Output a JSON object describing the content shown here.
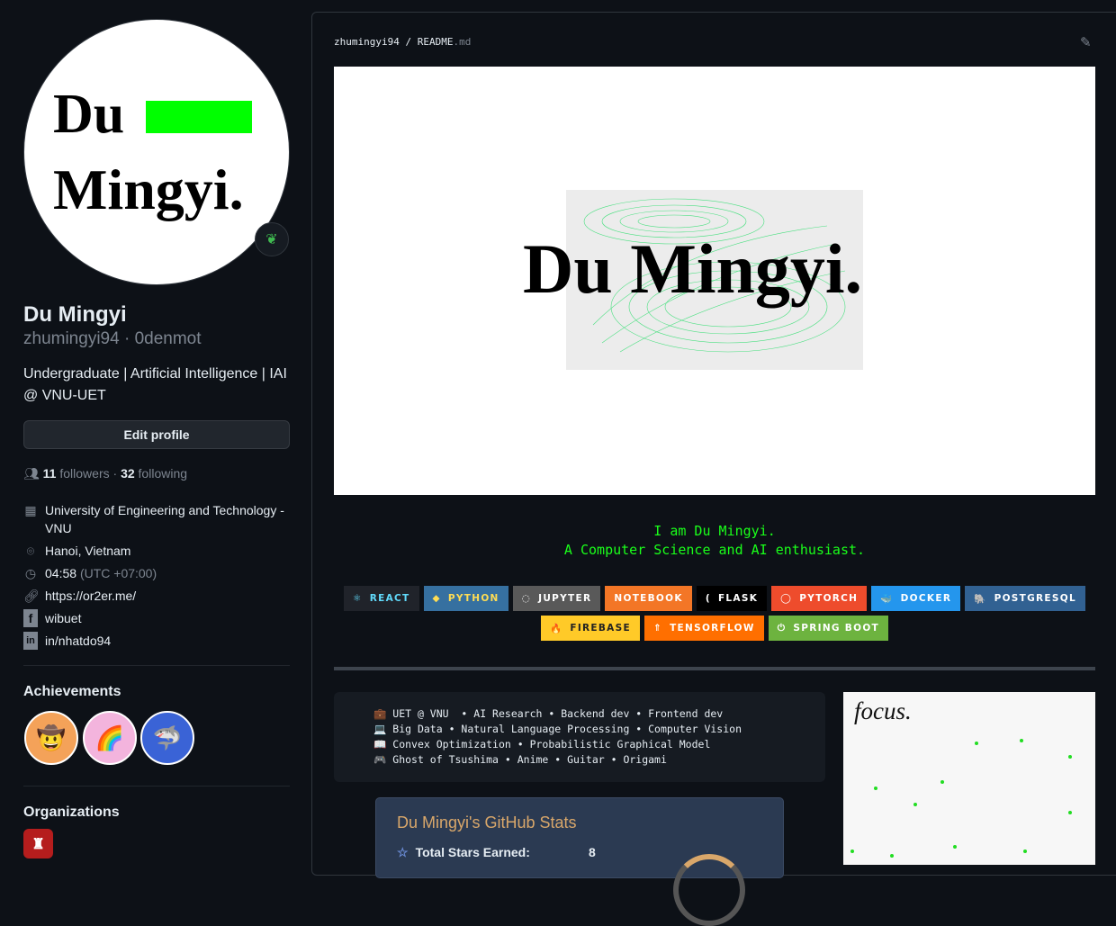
{
  "profile": {
    "avatar_text_1": "Du",
    "avatar_text_2": "Mingyi.",
    "name": "Du Mingyi",
    "login": "zhumingyi94",
    "pronouns_sep": " · ",
    "handle2": "0denmot",
    "bio": "Undergraduate | Artificial Intelligence | IAI @ VNU-UET",
    "edit_label": "Edit profile",
    "followers": "11",
    "followers_label": "followers",
    "following": "32",
    "following_label": "following",
    "org": "University of Engineering and Technology - VNU",
    "location": "Hanoi, Vietnam",
    "time": "04:58",
    "tz": "(UTC +07:00)",
    "website": "https://or2er.me/",
    "facebook": "wibuet",
    "linkedin": "in/nhatdo94",
    "achievements_title": "Achievements",
    "organizations_title": "Organizations"
  },
  "readme": {
    "owner": "zhumingyi94",
    "file": "README",
    "ext": ".md",
    "banner_text": "Du Mingyi.",
    "intro_1": "I am Du Mingyi.",
    "intro_2": "A Computer Science and AI enthusiast.",
    "badges_row1": [
      {
        "label": "REACT",
        "icon": "⚛",
        "bg": "#20232a",
        "fg": "#61dafb"
      },
      {
        "label": "PYTHON",
        "icon": "◆",
        "bg": "#3670a0",
        "fg": "#ffdd54"
      },
      {
        "label": "JUPYTER",
        "icon": "◌",
        "bg": "#595959",
        "fg": "#fff"
      },
      {
        "label": "NOTEBOOK",
        "icon": "",
        "bg": "#f37626",
        "fg": "#fff"
      },
      {
        "label": "FLASK",
        "icon": "(",
        "bg": "#000000",
        "fg": "#fff"
      },
      {
        "label": "PYTORCH",
        "icon": "◯",
        "bg": "#ee4c2c",
        "fg": "#fff"
      },
      {
        "label": "DOCKER",
        "icon": "🐳",
        "bg": "#2496ed",
        "fg": "#fff"
      },
      {
        "label": "POSTGRESQL",
        "icon": "🐘",
        "bg": "#316192",
        "fg": "#fff"
      }
    ],
    "badges_row2": [
      {
        "label": "FIREBASE",
        "icon": "🔥",
        "bg": "#ffca28",
        "fg": "#222"
      },
      {
        "label": "TENSORFLOW",
        "icon": "⇑",
        "bg": "#ff6f00",
        "fg": "#fff"
      },
      {
        "label": "SPRING BOOT",
        "icon": "⏻",
        "bg": "#6db33f",
        "fg": "#fff"
      }
    ],
    "info_lines": [
      {
        "icon": "💼",
        "text": "UET @ VNU  • AI Research • Backend dev • Frontend dev"
      },
      {
        "icon": "💻",
        "text": "Big Data • Natural Language Processing • Computer Vision"
      },
      {
        "icon": "📖",
        "text": "Convex Optimization • Probabilistic Graphical Model"
      },
      {
        "icon": "🎮",
        "text": "Ghost of Tsushima • Anime • Guitar • Origami"
      }
    ],
    "focus_text": "focus.",
    "stats": {
      "title": "Du Mingyi's GitHub Stats",
      "stars_label": "Total Stars Earned:",
      "stars_value": "8"
    }
  }
}
